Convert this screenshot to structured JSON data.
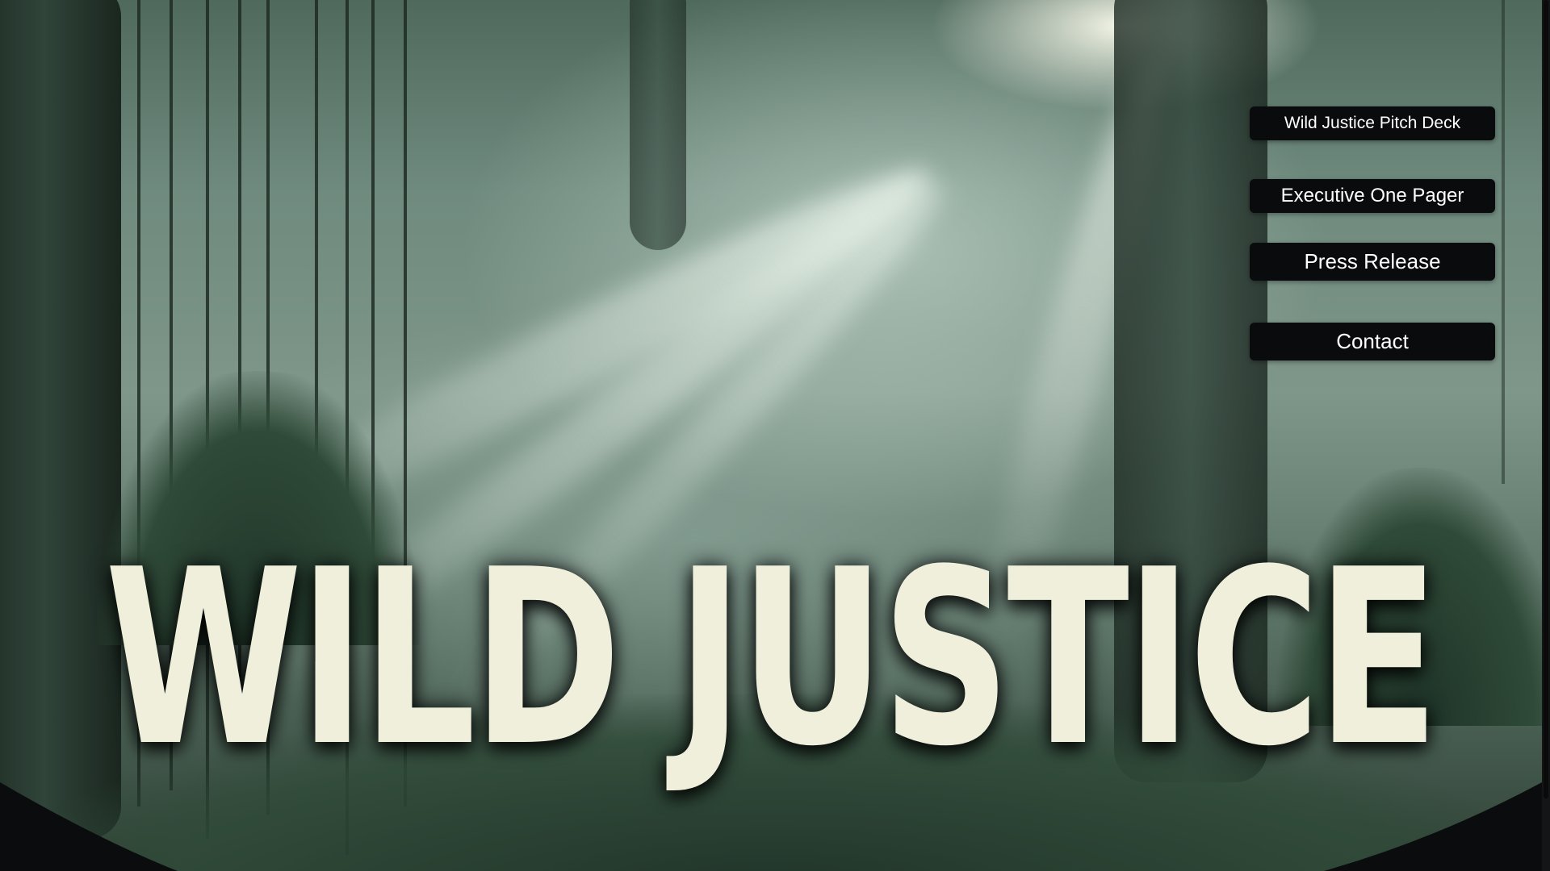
{
  "hero": {
    "title": "WILD JUSTICE",
    "background": "misty-jungle-sunbeams-image"
  },
  "nav": {
    "items": [
      {
        "label": "Wild Justice Pitch Deck"
      },
      {
        "label": "Executive One Pager"
      },
      {
        "label": "Press Release"
      },
      {
        "label": "Contact"
      }
    ]
  },
  "colors": {
    "button_bg": "#0a0b0d",
    "button_text": "#ffffff",
    "title_text": "#efefdc",
    "page_bg": "#0b0c0e"
  }
}
